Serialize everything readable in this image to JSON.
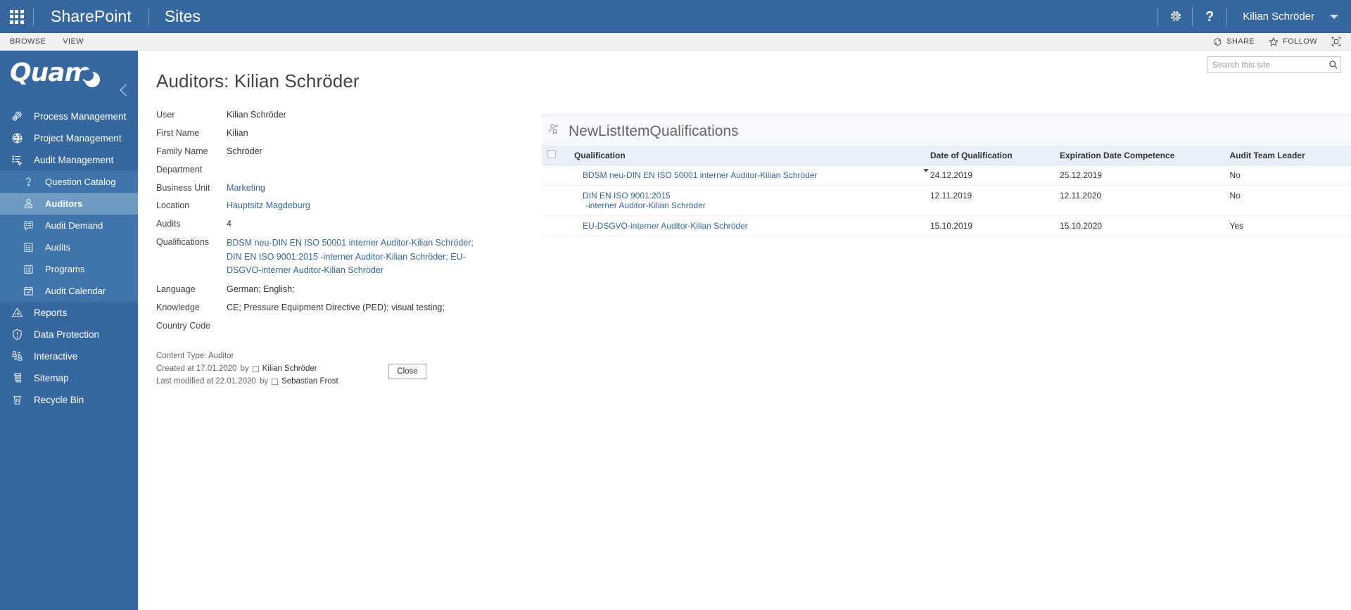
{
  "suite": {
    "waffle_icon": "app-launcher-icon",
    "brand": "SharePoint",
    "site": "Sites",
    "settings_icon": "gear-icon",
    "help_icon": "question-mark-icon",
    "user": "Kilian Schröder"
  },
  "ribbon": {
    "tabs": [
      "BROWSE",
      "VIEW"
    ],
    "share": "SHARE",
    "follow": "FOLLOW",
    "focus_icon": "focus-on-content-icon"
  },
  "search": {
    "placeholder": "Search this site",
    "value": "",
    "icon": "search-icon"
  },
  "sidebar": {
    "logo": "Quam",
    "collapse_icon": "chevron-left-icon",
    "items": [
      {
        "label": "Process Management",
        "icon": "gears-icon",
        "level": "top",
        "active": false
      },
      {
        "label": "Project Management",
        "icon": "globe-box-icon",
        "level": "top",
        "active": false
      },
      {
        "label": "Audit Management",
        "icon": "list-cursor-icon",
        "level": "top",
        "active": false
      },
      {
        "label": "Question Catalog",
        "icon": "question-mark-icon",
        "level": "sub",
        "active": false
      },
      {
        "label": "Auditors",
        "icon": "person-badge-icon",
        "level": "sub",
        "active": true
      },
      {
        "label": "Audit Demand",
        "icon": "list-speech-icon",
        "level": "sub",
        "active": false
      },
      {
        "label": "Audits",
        "icon": "list-document-icon",
        "level": "sub",
        "active": false
      },
      {
        "label": "Programs",
        "icon": "list-clipboard-icon",
        "level": "sub",
        "active": false
      },
      {
        "label": "Audit Calendar",
        "icon": "calendar-check-icon",
        "level": "sub",
        "active": false
      },
      {
        "label": "Reports",
        "icon": "chart-triangle-icon",
        "level": "top",
        "active": false
      },
      {
        "label": "Data Protection",
        "icon": "shield-alert-icon",
        "level": "top",
        "active": false
      },
      {
        "label": "Interactive",
        "icon": "two-people-exchange-icon",
        "level": "top",
        "active": false
      },
      {
        "label": "Sitemap",
        "icon": "sitemap-icon",
        "level": "top",
        "active": false
      },
      {
        "label": "Recycle Bin",
        "icon": "trash-icon",
        "level": "top",
        "active": false
      }
    ]
  },
  "page": {
    "title": "Auditors: Kilian Schröder"
  },
  "form": {
    "fields": [
      {
        "label": "User",
        "value": "Kilian Schröder",
        "link": false
      },
      {
        "label": "First Name",
        "value": "Kilian",
        "link": false
      },
      {
        "label": "Family Name",
        "value": "Schröder",
        "link": false
      },
      {
        "label": "Department",
        "value": "",
        "link": false
      },
      {
        "label": "Business Unit",
        "value": "Marketing",
        "link": true
      },
      {
        "label": "Location",
        "value": "Hauptsitz Magdeburg",
        "link": true
      },
      {
        "label": "Audits",
        "value": "4",
        "link": false
      },
      {
        "label": "Qualifications",
        "value": "BDSM neu-DIN EN ISO 50001 interner Auditor-Kilian Schröder; DIN EN ISO 9001:2015 -interner Auditor-Kilian Schröder; EU-DSGVO-interner Auditor-Kilian Schröder",
        "link": true
      },
      {
        "label": "Language",
        "value": "German; English;",
        "link": false
      },
      {
        "label": "Knowledge",
        "value": "CE; Pressure Equipment Directive (PED); visual testing;",
        "link": false
      },
      {
        "label": "Country Code",
        "value": "",
        "link": false
      }
    ],
    "meta": {
      "content_type": "Content Type: Auditor",
      "created_prefix": "Created at 17.01.2020",
      "created_by_label": "by",
      "created_by": "Kilian Schröder",
      "modified_prefix": "Last modified at 22.01.2020",
      "modified_by_label": "by",
      "modified_by": "Sebastian Frost"
    },
    "close_label": "Close"
  },
  "list": {
    "icon": "add-person-bookmark-icon",
    "title": "NewListItemQualifications",
    "columns": [
      "Qualification",
      "Date of Qualification",
      "Expiration Date Competence",
      "Audit Team Leader"
    ],
    "rows": [
      {
        "qualification": "BDSM neu-DIN EN ISO 50001 interner Auditor-Kilian Schröder",
        "qualification_line2": "",
        "date_of_qualification": "24.12.2019",
        "expiration_date": "25.12.2019",
        "audit_team_leader": "No",
        "has_caret": true
      },
      {
        "qualification": "DIN EN ISO 9001:2015",
        "qualification_line2": "-interner Auditor-Kilian Schröder",
        "date_of_qualification": "12.11.2019",
        "expiration_date": "12.11.2020",
        "audit_team_leader": "No",
        "has_caret": false
      },
      {
        "qualification": "EU-DSGVO-interner Auditor-Kilian Schröder",
        "qualification_line2": "",
        "date_of_qualification": "15.10.2019",
        "expiration_date": "15.10.2020",
        "audit_team_leader": "Yes",
        "has_caret": false
      }
    ]
  },
  "colors": {
    "suite_bar": "#36679e",
    "sidebar": "#36679e",
    "sidebar_sub": "#3f73ab",
    "sidebar_active": "#6e9ac4",
    "link": "#36679e",
    "table_header": "#e9eff7"
  }
}
